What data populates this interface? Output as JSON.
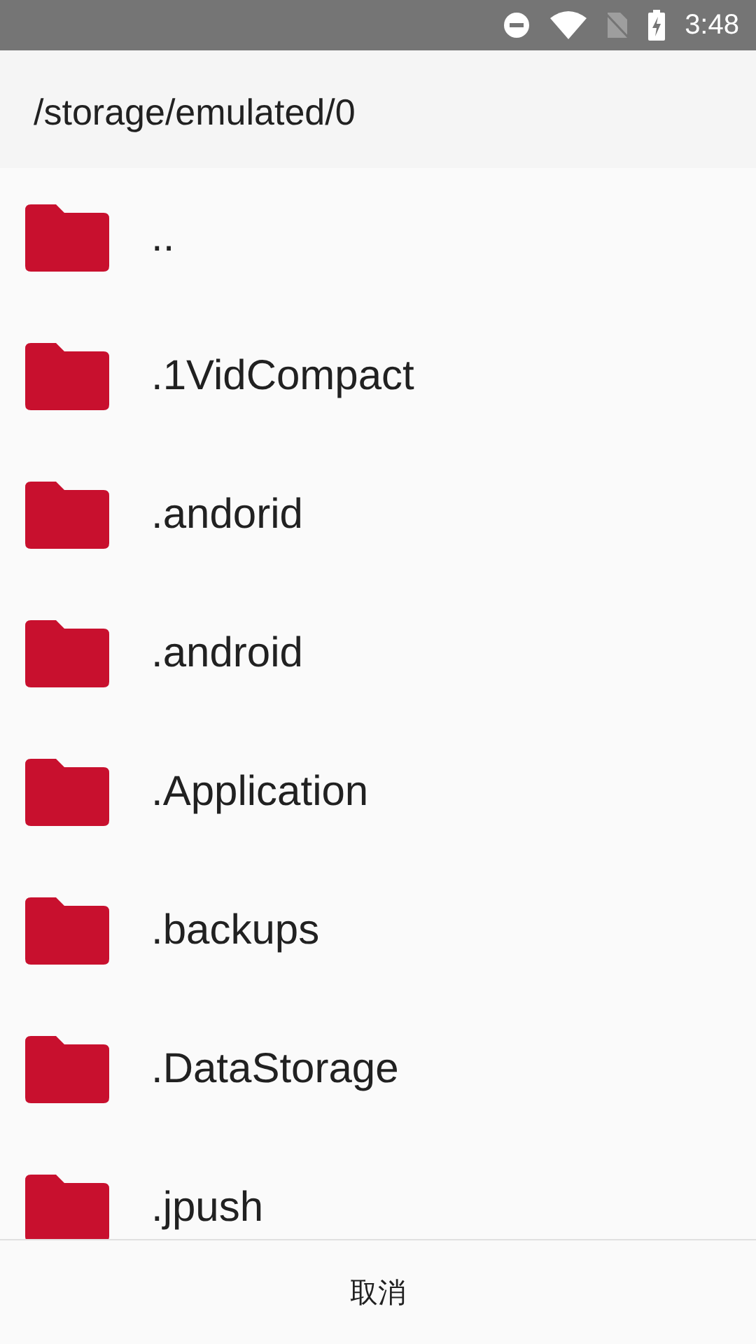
{
  "status_bar": {
    "time": "3:48"
  },
  "header": {
    "path": "/storage/emulated/0"
  },
  "folders": [
    {
      "name": ".."
    },
    {
      "name": ".1VidCompact"
    },
    {
      "name": ".andorid"
    },
    {
      "name": ".android"
    },
    {
      "name": ".Application"
    },
    {
      "name": ".backups"
    },
    {
      "name": ".DataStorage"
    },
    {
      "name": ".jpush"
    }
  ],
  "footer": {
    "cancel": "取消"
  }
}
